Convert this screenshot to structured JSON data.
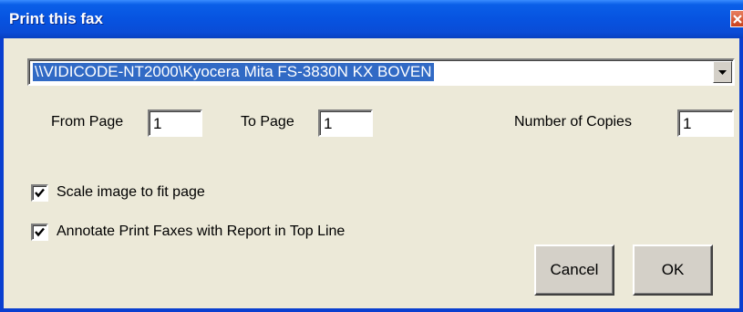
{
  "window": {
    "title": "Print this fax",
    "close_icon": "close-icon"
  },
  "printer": {
    "selected": "\\\\VIDICODE-NT2000\\Kyocera Mita FS-3830N KX BOVEN",
    "dropdown_icon": "chevron-down-icon"
  },
  "pages": {
    "from_label": "From Page",
    "from_value": "1",
    "to_label": "To Page",
    "to_value": "1",
    "copies_label": "Number of Copies",
    "copies_value": "1"
  },
  "options": {
    "scale_label": "Scale image to fit page",
    "scale_checked": true,
    "annotate_label": "Annotate Print Faxes with Report in Top Line",
    "annotate_checked": true
  },
  "buttons": {
    "cancel": "Cancel",
    "ok": "OK"
  },
  "colors": {
    "titlebar": "#0a4cd6",
    "selection": "#316ac5",
    "dialog_bg": "#ece9d8",
    "close_button": "#d05030"
  }
}
